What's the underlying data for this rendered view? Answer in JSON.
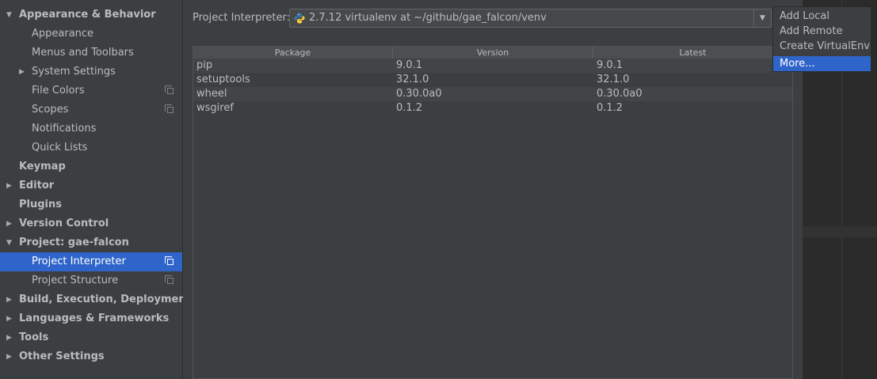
{
  "sidebar": {
    "items": [
      {
        "label": "Appearance & Behavior",
        "bold": true,
        "arrow": "▼",
        "indent": 0
      },
      {
        "label": "Appearance",
        "indent": 1
      },
      {
        "label": "Menus and Toolbars",
        "indent": 1
      },
      {
        "label": "System Settings",
        "arrow": "▶",
        "indent": 1
      },
      {
        "label": "File Colors",
        "indent": 1,
        "copy": true
      },
      {
        "label": "Scopes",
        "indent": 1,
        "copy": true
      },
      {
        "label": "Notifications",
        "indent": 1
      },
      {
        "label": "Quick Lists",
        "indent": 1
      },
      {
        "label": "Keymap",
        "bold": true,
        "indent": 0
      },
      {
        "label": "Editor",
        "bold": true,
        "arrow": "▶",
        "indent": 0
      },
      {
        "label": "Plugins",
        "bold": true,
        "indent": 0
      },
      {
        "label": "Version Control",
        "bold": true,
        "arrow": "▶",
        "indent": 0
      },
      {
        "label": "Project: gae-falcon",
        "bold": true,
        "arrow": "▼",
        "indent": 0
      },
      {
        "label": "Project Interpreter",
        "indent": 1,
        "copy": true,
        "selected": true
      },
      {
        "label": "Project Structure",
        "indent": 1,
        "copy": true
      },
      {
        "label": "Build, Execution, Deployment",
        "bold": true,
        "arrow": "▶",
        "indent": 0
      },
      {
        "label": "Languages & Frameworks",
        "bold": true,
        "arrow": "▶",
        "indent": 0
      },
      {
        "label": "Tools",
        "bold": true,
        "arrow": "▶",
        "indent": 0
      },
      {
        "label": "Other Settings",
        "bold": true,
        "arrow": "▶",
        "indent": 0
      }
    ]
  },
  "interpreter": {
    "label": "Project Interpreter:",
    "value": "2.7.12 virtualenv at ~/github/gae_falcon/venv",
    "dropdown_icon": "chevron-down-icon"
  },
  "table": {
    "columns": [
      "Package",
      "Version",
      "Latest"
    ],
    "rows": [
      [
        "pip",
        "9.0.1",
        "9.0.1"
      ],
      [
        "setuptools",
        "32.1.0",
        "32.1.0"
      ],
      [
        "wheel",
        "0.30.0a0",
        "0.30.0a0"
      ],
      [
        "wsgiref",
        "0.1.2",
        "0.1.2"
      ]
    ]
  },
  "menu": {
    "items": [
      {
        "label": "Add Local"
      },
      {
        "label": "Add Remote"
      },
      {
        "label": "Create VirtualEnv"
      },
      {
        "label": "More...",
        "active": true
      }
    ]
  },
  "colors": {
    "selection": "#2f65ca",
    "background": "#3c3f41",
    "text": "#bbbbbb"
  }
}
